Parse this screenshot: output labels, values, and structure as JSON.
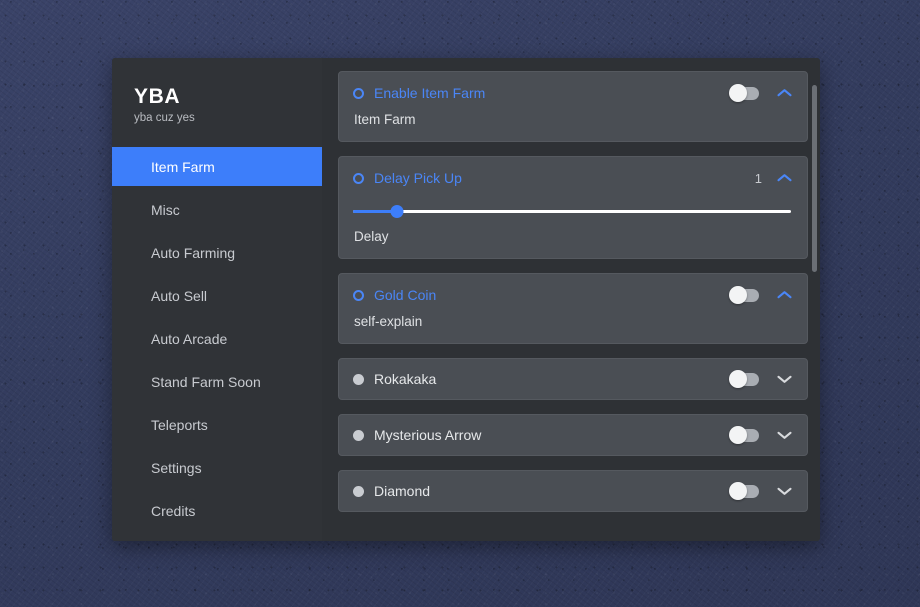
{
  "window": {
    "brand_title": "YBA",
    "brand_subtitle": "yba cuz yes"
  },
  "colors": {
    "accent_blue": "#3d7efa",
    "title_blue": "#4a86f7",
    "card_bg": "#4a4e54",
    "sidebar_bg": "#303337",
    "content_bg": "#2e3135",
    "desktop_bg": "#363f63",
    "toggle_off_track": "#a9adb3",
    "toggle_knob": "#f3f4f5"
  },
  "sidebar": {
    "items": [
      {
        "label": "Item Farm",
        "active": true
      },
      {
        "label": "Misc",
        "active": false
      },
      {
        "label": "Auto Farming",
        "active": false
      },
      {
        "label": "Auto Sell",
        "active": false
      },
      {
        "label": "Auto Arcade",
        "active": false
      },
      {
        "label": "Stand Farm Soon",
        "active": false
      },
      {
        "label": "Teleports",
        "active": false
      },
      {
        "label": "Settings",
        "active": false
      },
      {
        "label": "Credits",
        "active": false
      }
    ]
  },
  "content": {
    "cards": [
      {
        "title": "Enable Item Farm",
        "description": "Item Farm",
        "expanded": true,
        "bullet": "ring-icon",
        "toggle": {
          "state": "off"
        },
        "chevron": "chevron-up-icon"
      },
      {
        "title": "Delay Pick Up",
        "description": "Delay",
        "expanded": true,
        "bullet": "ring-icon",
        "value": "1",
        "slider": {
          "value": 1,
          "min": 0,
          "max": 100,
          "percent": 10
        },
        "chevron": "chevron-up-icon"
      },
      {
        "title": "Gold Coin",
        "description": "self-explain",
        "expanded": true,
        "bullet": "ring-icon",
        "toggle": {
          "state": "off"
        },
        "chevron": "chevron-up-icon"
      },
      {
        "title": "Rokakaka",
        "expanded": false,
        "bullet": "dot-icon",
        "toggle": {
          "state": "off"
        },
        "chevron": "chevron-down-icon"
      },
      {
        "title": "Mysterious Arrow",
        "expanded": false,
        "bullet": "dot-icon",
        "toggle": {
          "state": "off"
        },
        "chevron": "chevron-down-icon"
      },
      {
        "title": "Diamond",
        "expanded": false,
        "bullet": "dot-icon",
        "toggle": {
          "state": "off"
        },
        "chevron": "chevron-down-icon"
      }
    ]
  }
}
